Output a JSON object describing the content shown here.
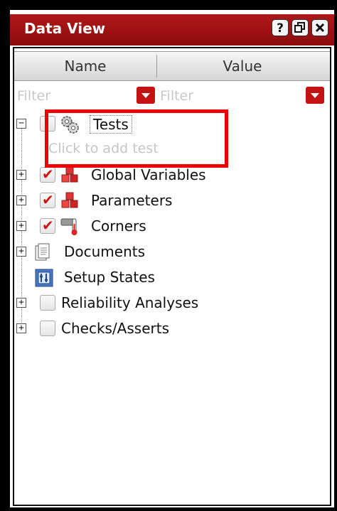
{
  "window": {
    "title": "Data View",
    "buttons": [
      {
        "name": "help-button",
        "label": "?"
      },
      {
        "name": "restore-button",
        "label": "🗗"
      },
      {
        "name": "close-button",
        "label": "✕"
      }
    ]
  },
  "columns": {
    "name": "Name",
    "value": "Value"
  },
  "filters": {
    "name_placeholder": "Filter",
    "value_placeholder": "Filter"
  },
  "tree": {
    "tests": {
      "label": "Tests",
      "add_placeholder": "Click to add test"
    },
    "items": [
      {
        "label": "Global Variables",
        "checked": true,
        "icon": "cubes-icon"
      },
      {
        "label": "Parameters",
        "checked": true,
        "icon": "cubes-icon"
      },
      {
        "label": "Corners",
        "checked": true,
        "icon": "thermometer-icon"
      },
      {
        "label": "Documents",
        "icon": "document-icon"
      },
      {
        "label": "Setup States",
        "icon": "setup-state-icon"
      },
      {
        "label": "Reliability Analyses",
        "checked": false
      },
      {
        "label": "Checks/Asserts",
        "checked": false
      }
    ]
  },
  "colors": {
    "accent": "#a51212",
    "check": "#d21010",
    "highlight": "#ee0000"
  }
}
